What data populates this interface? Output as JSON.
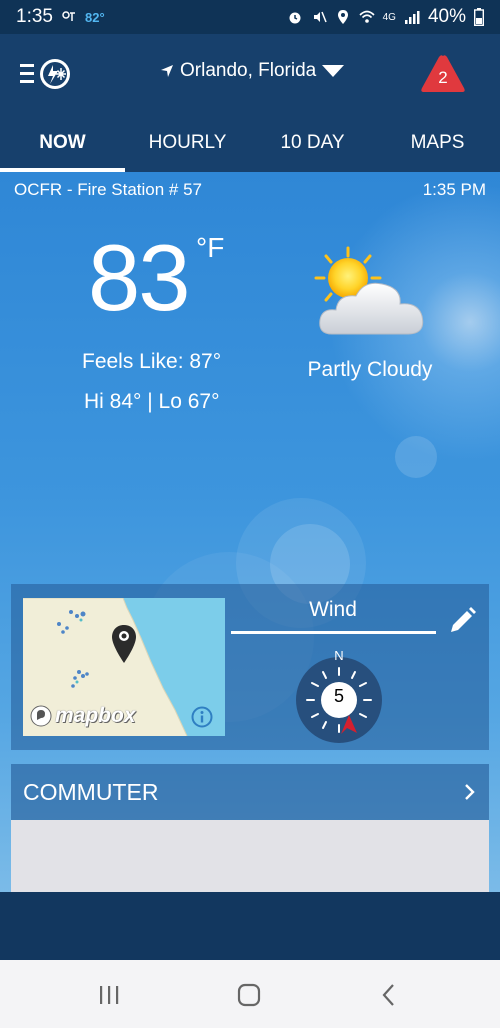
{
  "status_bar": {
    "time": "1:35",
    "temperature": "82°",
    "network": "4G",
    "battery": "40%"
  },
  "header": {
    "location": "Orlando, Florida",
    "alert_count": "2",
    "tabs": [
      {
        "label": "NOW",
        "active": true
      },
      {
        "label": "HOURLY",
        "active": false
      },
      {
        "label": "10 DAY",
        "active": false
      },
      {
        "label": "MAPS",
        "active": false
      }
    ]
  },
  "current": {
    "station": "OCFR - Fire Station # 57",
    "time": "1:35 PM",
    "temperature": "83",
    "unit": "°F",
    "feels_like": "Feels Like: 87°",
    "hi_lo": "Hi 84° | Lo 67°",
    "condition": "Partly Cloudy",
    "condition_icon": "partly-cloudy-icon"
  },
  "widgets": {
    "map_attribution": "mapbox",
    "wind_title": "Wind",
    "wind_speed": "5",
    "compass_north": "N"
  },
  "commuter": {
    "title": "COMMUTER"
  },
  "colors": {
    "header_bg": "#17406c",
    "sky_top": "#2f87d6",
    "alert_red": "#e0393e",
    "compass_pointer": "#d3202f"
  }
}
